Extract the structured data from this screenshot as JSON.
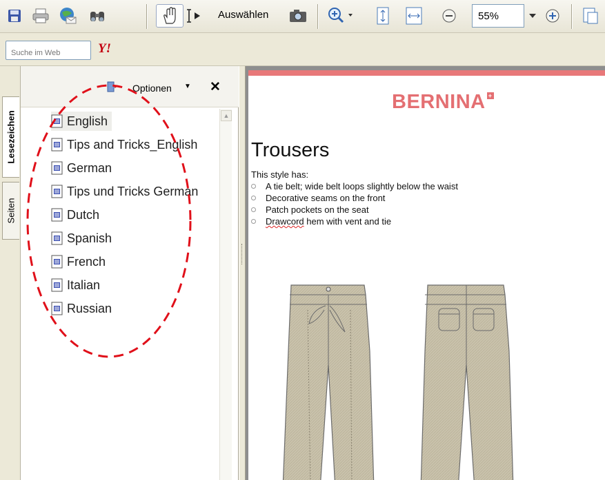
{
  "toolbar": {
    "auswahl_label": "Auswählen",
    "zoom_value": "55%",
    "icons": [
      "save-icon",
      "print-icon",
      "email-icon",
      "search-binoculars-icon",
      "hand-tool-icon",
      "select-text-icon",
      "snapshot-icon",
      "zoom-in-icon",
      "fit-page-icon",
      "fit-width-icon",
      "zoom-out-icon",
      "zoom-plus-icon",
      "export-icon"
    ]
  },
  "search": {
    "placeholder": "Suche im Web",
    "yahoo_logo": "Y!"
  },
  "side_tabs": {
    "bookmarks": "Lesezeichen",
    "pages": "Seiten"
  },
  "bookmarks_panel": {
    "options_label": "Optionen",
    "close_label": "✕",
    "items": [
      {
        "label": "English"
      },
      {
        "label": "Tips and Tricks_English"
      },
      {
        "label": "German"
      },
      {
        "label": "Tips und Tricks German"
      },
      {
        "label": "Dutch"
      },
      {
        "label": "Spanish"
      },
      {
        "label": "French"
      },
      {
        "label": "Italian"
      },
      {
        "label": "Russian"
      }
    ]
  },
  "document": {
    "brand": "BERNINA",
    "title": "Trousers",
    "subtitle": "This style has:",
    "bullets": [
      "A tie belt; wide belt loops slightly below the waist",
      "Decorative seams on the front",
      "Patch pockets on the seat",
      "Drawcord hem with vent and tie"
    ],
    "misspelled_word": "Drawcord"
  },
  "colors": {
    "brand": "#e46f72",
    "annotation": "#e0101a",
    "fabric": "#c9c2ac"
  }
}
